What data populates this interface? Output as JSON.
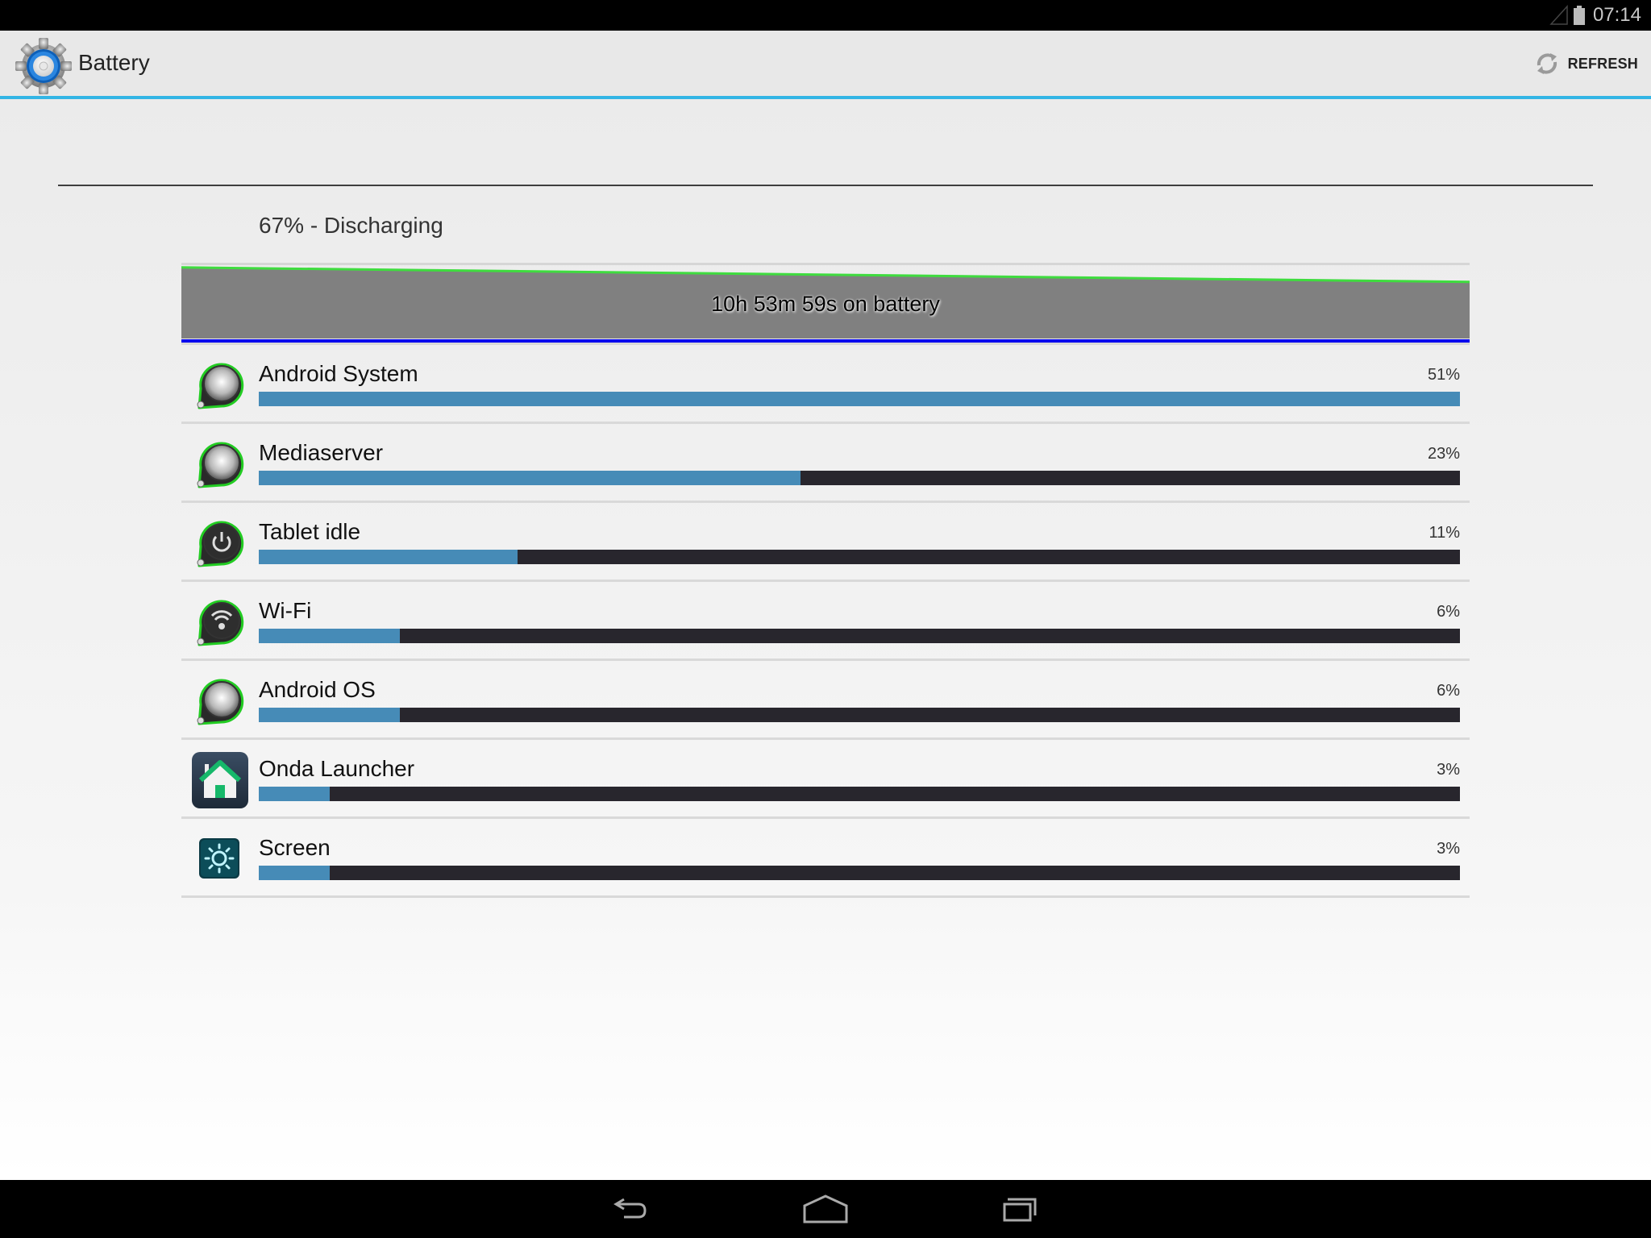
{
  "status_bar": {
    "time": "07:14",
    "icons": [
      "signal-icon",
      "battery-icon"
    ]
  },
  "action_bar": {
    "title": "Battery",
    "app_icon": "settings-gear-icon",
    "refresh_label": "REFRESH",
    "refresh_icon": "refresh-icon",
    "accent_color": "#33b5e5"
  },
  "battery": {
    "summary": "67% - Discharging",
    "level_percent": 67,
    "graph_label": "10h 53m 59s on battery",
    "graph_start_level": 0.97,
    "graph_end_level": 0.67
  },
  "usage": {
    "items": [
      {
        "name": "Android System",
        "percent": 51,
        "percent_label": "51%",
        "icon": "android-system-icon"
      },
      {
        "name": "Mediaserver",
        "percent": 23,
        "percent_label": "23%",
        "icon": "mediaserver-icon"
      },
      {
        "name": "Tablet idle",
        "percent": 11,
        "percent_label": "11%",
        "icon": "power-icon"
      },
      {
        "name": "Wi-Fi",
        "percent": 6,
        "percent_label": "6%",
        "icon": "wifi-icon"
      },
      {
        "name": "Android OS",
        "percent": 6,
        "percent_label": "6%",
        "icon": "android-os-icon"
      },
      {
        "name": "Onda Launcher",
        "percent": 3,
        "percent_label": "3%",
        "icon": "launcher-home-icon"
      },
      {
        "name": "Screen",
        "percent": 3,
        "percent_label": "3%",
        "icon": "screen-brightness-icon"
      }
    ],
    "bar_fill_color": "#468bb7",
    "bar_track_color": "#28262d"
  },
  "nav_bar": {
    "buttons": [
      "back",
      "home",
      "recent-apps"
    ]
  }
}
